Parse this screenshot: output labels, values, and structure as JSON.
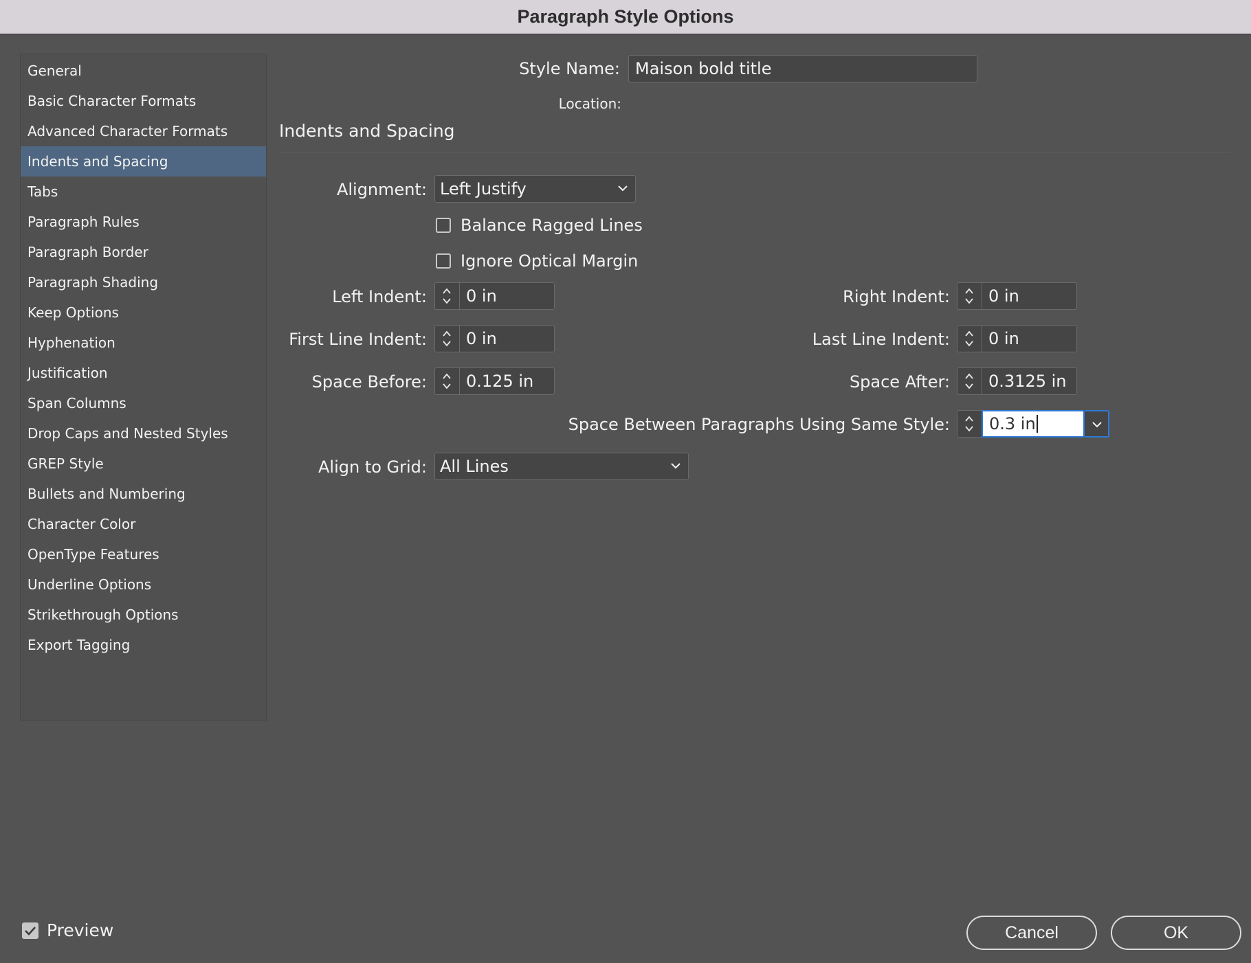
{
  "window": {
    "title": "Paragraph Style Options"
  },
  "sidebar": {
    "items": [
      {
        "label": "General"
      },
      {
        "label": "Basic Character Formats"
      },
      {
        "label": "Advanced Character Formats"
      },
      {
        "label": "Indents and Spacing",
        "selected": true
      },
      {
        "label": "Tabs"
      },
      {
        "label": "Paragraph Rules"
      },
      {
        "label": "Paragraph Border"
      },
      {
        "label": "Paragraph Shading"
      },
      {
        "label": "Keep Options"
      },
      {
        "label": "Hyphenation"
      },
      {
        "label": "Justification"
      },
      {
        "label": "Span Columns"
      },
      {
        "label": "Drop Caps and Nested Styles"
      },
      {
        "label": "GREP Style"
      },
      {
        "label": "Bullets and Numbering"
      },
      {
        "label": "Character Color"
      },
      {
        "label": "OpenType Features"
      },
      {
        "label": "Underline Options"
      },
      {
        "label": "Strikethrough Options"
      },
      {
        "label": "Export Tagging"
      }
    ]
  },
  "header": {
    "style_name_label": "Style Name:",
    "style_name_value": "Maison bold title",
    "location_label": "Location:"
  },
  "section": {
    "title": "Indents and Spacing"
  },
  "form": {
    "alignment": {
      "label": "Alignment:",
      "value": "Left Justify"
    },
    "balance_ragged": {
      "label": "Balance Ragged Lines",
      "checked": false
    },
    "ignore_optical": {
      "label": "Ignore Optical Margin",
      "checked": false
    },
    "left_indent": {
      "label": "Left Indent:",
      "value": "0 in"
    },
    "right_indent": {
      "label": "Right Indent:",
      "value": "0 in"
    },
    "first_line_indent": {
      "label": "First Line Indent:",
      "value": "0 in"
    },
    "last_line_indent": {
      "label": "Last Line Indent:",
      "value": "0 in"
    },
    "space_before": {
      "label": "Space Before:",
      "value": "0.125 in"
    },
    "space_after": {
      "label": "Space After:",
      "value": "0.3125 in"
    },
    "space_between": {
      "label": "Space Between Paragraphs Using Same Style:",
      "value": "0.3 in"
    },
    "align_to_grid": {
      "label": "Align to Grid:",
      "value": "All Lines"
    }
  },
  "footer": {
    "preview_label": "Preview",
    "preview_checked": true,
    "cancel_label": "Cancel",
    "ok_label": "OK"
  },
  "colors": {
    "background": "#535353",
    "selection": "#4f6782",
    "focus_ring": "#2e7ad6"
  },
  "icons": [
    "chevron-down-icon",
    "stepper-up-icon",
    "stepper-down-icon",
    "checkmark-icon"
  ]
}
